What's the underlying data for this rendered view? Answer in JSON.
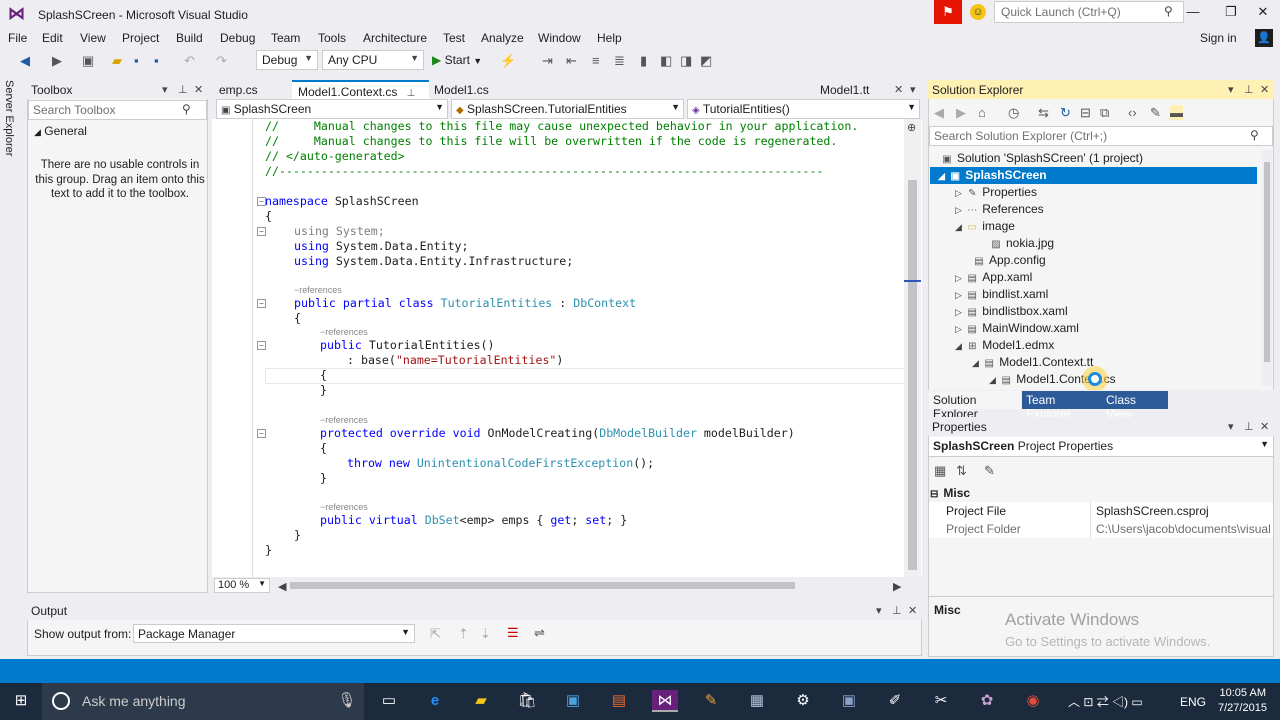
{
  "window": {
    "title": "SplashSCreen - Microsoft Visual Studio",
    "quick_launch_placeholder": "Quick Launch (Ctrl+Q)"
  },
  "menu": [
    "File",
    "Edit",
    "View",
    "Project",
    "Build",
    "Debug",
    "Team",
    "Tools",
    "Architecture",
    "Test",
    "Analyze",
    "Window",
    "Help"
  ],
  "signin": "Sign in",
  "toolbar": {
    "config": "Debug",
    "platform": "Any CPU",
    "start": "Start"
  },
  "server_explorer": "Server Explorer",
  "toolbox": {
    "title": "Toolbox",
    "search_placeholder": "Search Toolbox",
    "group": "General",
    "empty_message": "There are no usable controls in this group. Drag an item onto this text to add it to the toolbox."
  },
  "doc_tabs": {
    "left": [
      "emp.cs",
      "Model1.Context.cs",
      "Model1.cs"
    ],
    "active": "Model1.Context.cs",
    "right": "Model1.tt"
  },
  "nav": {
    "project": "SplashSCreen",
    "type": "SplashSCreen.TutorialEntities",
    "member": "TutorialEntities()"
  },
  "code": {
    "l1": "//     Manual changes to this file may cause unexpected behavior in your application.",
    "l2": "//     Manual changes to this file will be overwritten if the code is regenerated.",
    "l3": "// </auto-generated>",
    "l4": "//------------------------------------------------------------------------------",
    "ns_kw": "namespace",
    "ns_name": "SplashSCreen",
    "brace_open": "{",
    "brace_close": "}",
    "using": "using",
    "u1": "System;",
    "u2": "System.Data.Entity;",
    "u3": "System.Data.Entity.Infrastructure;",
    "refs": "references",
    "class_mods": "public partial class",
    "class_name": "TutorialEntities",
    "colon": " : ",
    "base_class": "DbContext",
    "public": "public",
    "ctor_name": "TutorialEntities()",
    "base_call_a": ": base(",
    "base_call_str": "\"name=TutorialEntities\"",
    "base_call_b": ")",
    "protected_override_void": "protected override void",
    "method_name": "OnModelCreating(",
    "dbmb": "DbModelBuilder",
    "method_param": " modelBuilder)",
    "throw_new": "throw new",
    "exc": "UnintentionalCodeFirstException",
    "exc_tail": "();",
    "public_virtual": "public virtual",
    "dbset": "DbSet",
    "dbset_tail": "<emp> emps { ",
    "get_kw": "get",
    "semi": "; ",
    "set_kw": "set",
    "end": "; }"
  },
  "zoom": "100 %",
  "output": {
    "title": "Output",
    "show_from_label": "Show output from:",
    "source": "Package Manager"
  },
  "solution_explorer": {
    "title": "Solution Explorer",
    "search_placeholder": "Search Solution Explorer (Ctrl+;)",
    "items": [
      "Solution 'SplashSCreen' (1 project)",
      "SplashSCreen",
      "Properties",
      "References",
      "image",
      "nokia.jpg",
      "App.config",
      "App.xaml",
      "bindlist.xaml",
      "bindlistbox.xaml",
      "MainWindow.xaml",
      "Model1.edmx",
      "Model1.Context.tt",
      "Model1.Context.cs"
    ],
    "bottom_tabs": [
      "Solution Explorer",
      "Team Explorer",
      "Class View"
    ]
  },
  "properties": {
    "title": "Properties",
    "object_name": "SplashSCreen",
    "object_type": "Project Properties",
    "category": "Misc",
    "rows": [
      {
        "name": "Project File",
        "value": "SplashSCreen.csproj"
      },
      {
        "name": "Project Folder",
        "value": "C:\\Users\\jacob\\documents\\visual st"
      }
    ],
    "desc_title": "Misc"
  },
  "activate": {
    "line1": "Activate Windows",
    "line2": "Go to Settings to activate Windows."
  },
  "taskbar": {
    "cortana": "Ask me anything",
    "lang": "ENG",
    "time": "10:05 AM",
    "date": "7/27/2015"
  },
  "colors": {
    "accent": "#007acc",
    "vs_purple": "#68217a",
    "taskbar": "#1c2a3d"
  }
}
